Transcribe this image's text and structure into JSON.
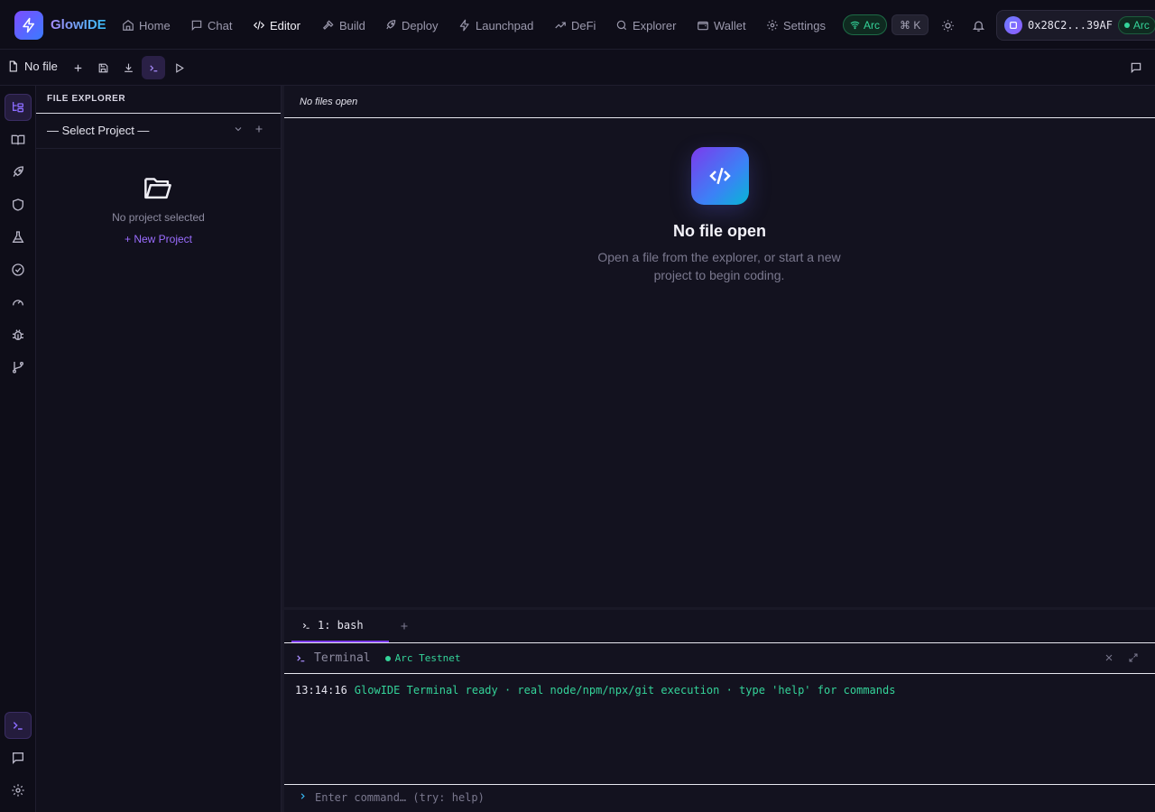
{
  "brand": {
    "name": "GlowIDE"
  },
  "nav": {
    "items": [
      {
        "label": "Home",
        "icon": "home-icon"
      },
      {
        "label": "Chat",
        "icon": "chat-icon"
      },
      {
        "label": "Editor",
        "icon": "code-icon",
        "active": true
      },
      {
        "label": "Build",
        "icon": "hammer-icon"
      },
      {
        "label": "Deploy",
        "icon": "rocket-icon"
      },
      {
        "label": "Launchpad",
        "icon": "zap-icon"
      },
      {
        "label": "DeFi",
        "icon": "trend-icon"
      },
      {
        "label": "Explorer",
        "icon": "search-icon"
      },
      {
        "label": "Wallet",
        "icon": "wallet-icon"
      },
      {
        "label": "Settings",
        "icon": "gear-icon"
      }
    ],
    "network_pill": "Arc",
    "shortcut": "⌘ K"
  },
  "wallet": {
    "address": "0x28C2...39AF",
    "network": "Arc"
  },
  "toolbar": {
    "file_label": "No file"
  },
  "explorer": {
    "title": "FILE EXPLORER",
    "project_select": "— Select Project —",
    "empty_text": "No project selected",
    "new_project": "+ New Project"
  },
  "editor": {
    "tabs_placeholder": "No files open",
    "empty_title": "No file open",
    "empty_subtitle": "Open a file from the explorer, or start a new project to begin coding."
  },
  "terminal": {
    "tab_label": "1: bash",
    "title": "Terminal",
    "network": "Arc Testnet",
    "output_time": "13:14:16",
    "output_message": "GlowIDE Terminal ready · real node/npm/npx/git execution · type 'help' for commands",
    "input_placeholder": "Enter command… (try: help)"
  },
  "colors": {
    "accent": "#7c3aed",
    "success": "#34d399",
    "background": "#13121f"
  }
}
